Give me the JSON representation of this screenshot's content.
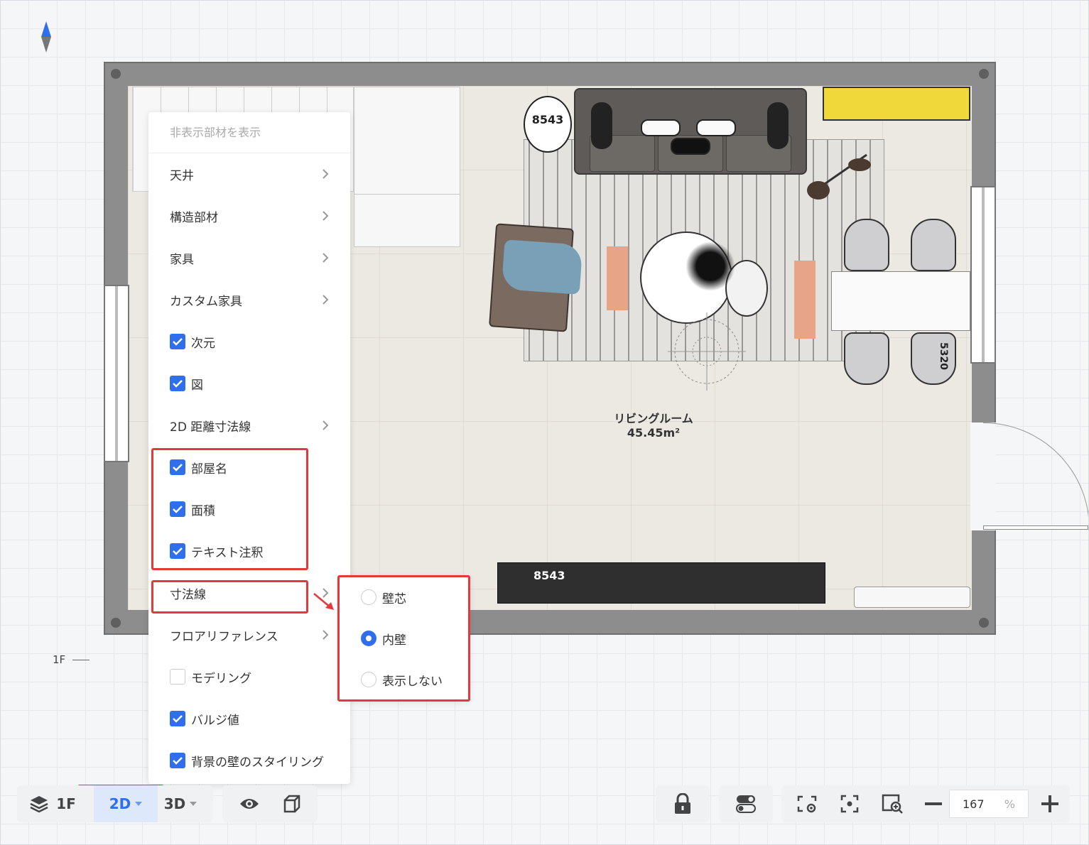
{
  "plan": {
    "room_name": "リビングルーム",
    "room_area": "45.45m²",
    "ottoman_label": "8543",
    "bench_label": "8543",
    "dimension_label": "5320",
    "floor_marker": "1F"
  },
  "menu": {
    "header": "非表示部材を表示",
    "items": [
      {
        "label": "天井",
        "type": "submenu"
      },
      {
        "label": "構造部材",
        "type": "submenu"
      },
      {
        "label": "家具",
        "type": "submenu"
      },
      {
        "label": "カスタム家具",
        "type": "submenu"
      },
      {
        "label": "次元",
        "type": "checkbox",
        "checked": true
      },
      {
        "label": "図",
        "type": "checkbox",
        "checked": true
      },
      {
        "label": "2D 距離寸法線",
        "type": "submenu"
      },
      {
        "label": "部屋名",
        "type": "checkbox",
        "checked": true
      },
      {
        "label": "面積",
        "type": "checkbox",
        "checked": true
      },
      {
        "label": "テキスト注釈",
        "type": "checkbox",
        "checked": true
      },
      {
        "label": "寸法線",
        "type": "submenu"
      },
      {
        "label": "フロアリファレンス",
        "type": "submenu"
      },
      {
        "label": "モデリング",
        "type": "checkbox",
        "checked": false
      },
      {
        "label": "バルジ値",
        "type": "checkbox",
        "checked": true
      },
      {
        "label": "背景の壁のスタイリング",
        "type": "checkbox",
        "checked": true
      }
    ]
  },
  "submenu": {
    "options": [
      {
        "label": "壁芯",
        "selected": false
      },
      {
        "label": "内壁",
        "selected": true
      },
      {
        "label": "表示しない",
        "selected": false
      }
    ]
  },
  "toolbar": {
    "floor_label": "1F",
    "view_2d_label": "2D",
    "view_3d_label": "3D",
    "zoom_value": "167",
    "zoom_unit": "%"
  },
  "colors": {
    "accent": "#2f6fed",
    "highlight": "#e5383b"
  }
}
